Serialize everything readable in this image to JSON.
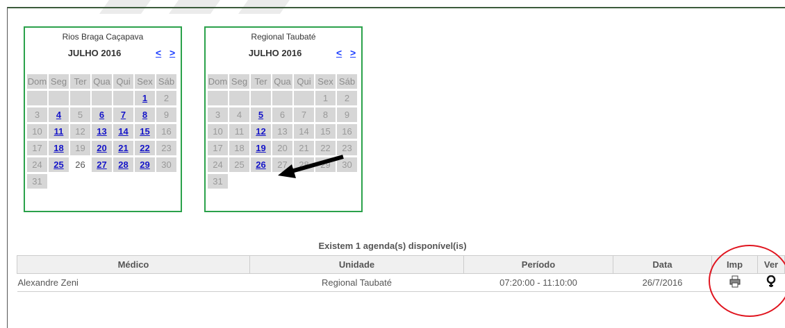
{
  "calendars": [
    {
      "unit": "Rios Braga Caçapava",
      "month": "JULHO 2016",
      "prev": "<",
      "next": ">",
      "weekdays": [
        "Dom",
        "Seg",
        "Ter",
        "Qua",
        "Qui",
        "Sex",
        "Sáb"
      ],
      "weeks": [
        [
          null,
          null,
          null,
          null,
          null,
          {
            "d": "1",
            "link": true
          },
          {
            "d": "2"
          }
        ],
        [
          {
            "d": "3"
          },
          {
            "d": "4",
            "link": true
          },
          {
            "d": "5"
          },
          {
            "d": "6",
            "link": true
          },
          {
            "d": "7",
            "link": true
          },
          {
            "d": "8",
            "link": true
          },
          {
            "d": "9"
          }
        ],
        [
          {
            "d": "10"
          },
          {
            "d": "11",
            "link": true
          },
          {
            "d": "12"
          },
          {
            "d": "13",
            "link": true
          },
          {
            "d": "14",
            "link": true
          },
          {
            "d": "15",
            "link": true
          },
          {
            "d": "16"
          }
        ],
        [
          {
            "d": "17"
          },
          {
            "d": "18",
            "link": true
          },
          {
            "d": "19"
          },
          {
            "d": "20",
            "link": true
          },
          {
            "d": "21",
            "link": true
          },
          {
            "d": "22",
            "link": true
          },
          {
            "d": "23"
          }
        ],
        [
          {
            "d": "24"
          },
          {
            "d": "25",
            "link": true
          },
          {
            "d": "26",
            "today": true
          },
          {
            "d": "27",
            "link": true
          },
          {
            "d": "28",
            "link": true
          },
          {
            "d": "29",
            "link": true
          },
          {
            "d": "30"
          }
        ],
        [
          {
            "d": "31"
          }
        ]
      ]
    },
    {
      "unit": "Regional Taubaté",
      "month": "JULHO 2016",
      "prev": "<",
      "next": ">",
      "weekdays": [
        "Dom",
        "Seg",
        "Ter",
        "Qua",
        "Qui",
        "Sex",
        "Sáb"
      ],
      "weeks": [
        [
          null,
          null,
          null,
          null,
          null,
          {
            "d": "1"
          },
          {
            "d": "2"
          }
        ],
        [
          {
            "d": "3"
          },
          {
            "d": "4"
          },
          {
            "d": "5",
            "link": true
          },
          {
            "d": "6"
          },
          {
            "d": "7"
          },
          {
            "d": "8"
          },
          {
            "d": "9"
          }
        ],
        [
          {
            "d": "10"
          },
          {
            "d": "11"
          },
          {
            "d": "12",
            "link": true
          },
          {
            "d": "13"
          },
          {
            "d": "14"
          },
          {
            "d": "15"
          },
          {
            "d": "16"
          }
        ],
        [
          {
            "d": "17"
          },
          {
            "d": "18"
          },
          {
            "d": "19",
            "link": true
          },
          {
            "d": "20"
          },
          {
            "d": "21"
          },
          {
            "d": "22"
          },
          {
            "d": "23"
          }
        ],
        [
          {
            "d": "24"
          },
          {
            "d": "25"
          },
          {
            "d": "26",
            "link": true,
            "selected": true
          },
          {
            "d": "27"
          },
          {
            "d": "28"
          },
          {
            "d": "29"
          },
          {
            "d": "30"
          }
        ],
        [
          {
            "d": "31"
          }
        ]
      ]
    }
  ],
  "agenda": {
    "caption": "Existem 1 agenda(s) disponível(is)",
    "headers": {
      "medico": "Médico",
      "unidade": "Unidade",
      "periodo": "Período",
      "data": "Data",
      "imp": "Imp",
      "ver": "Ver"
    },
    "rows": [
      {
        "medico": "Alexandre Zeni",
        "unidade": "Regional Taubaté",
        "periodo": "07:20:00 - 11:10:00",
        "data": "26/7/2016",
        "imp_icon": "printer-icon",
        "ver_icon": "magnifier-icon"
      }
    ]
  },
  "annotation_colors": {
    "arrow": "#000000",
    "circle": "#e0141e"
  }
}
